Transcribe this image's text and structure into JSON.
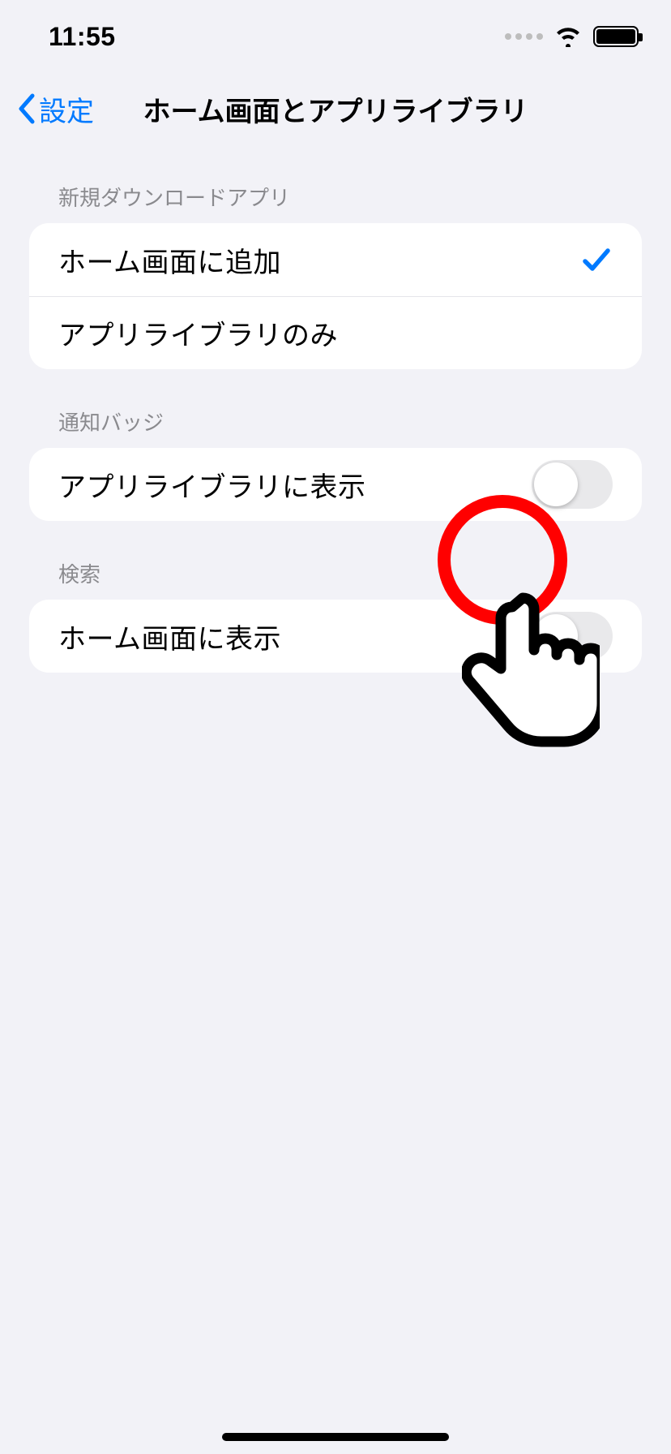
{
  "status": {
    "time": "11:55"
  },
  "nav": {
    "back": "設定",
    "title": "ホーム画面とアプリライブラリ"
  },
  "sections": {
    "downloads": {
      "header": "新規ダウンロードアプリ",
      "options": [
        {
          "label": "ホーム画面に追加",
          "selected": true
        },
        {
          "label": "アプリライブラリのみ",
          "selected": false
        }
      ]
    },
    "badges": {
      "header": "通知バッジ",
      "toggle": {
        "label": "アプリライブラリに表示",
        "on": false
      }
    },
    "search": {
      "header": "検索",
      "toggle": {
        "label": "ホーム画面に表示",
        "on": false
      }
    }
  }
}
